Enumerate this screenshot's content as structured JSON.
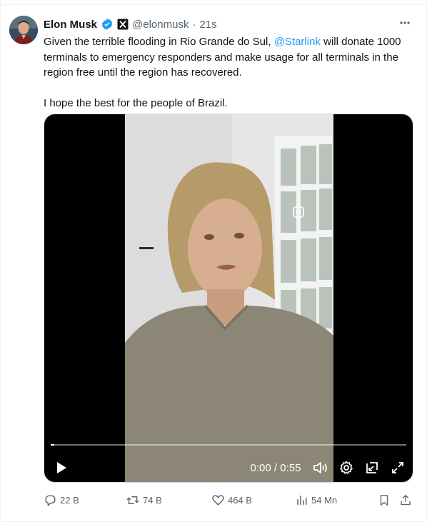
{
  "tweet": {
    "author_name": "Elon Musk",
    "handle": "@elonmusk",
    "separator": "·",
    "time": "21s",
    "text_part1": "Given the terrible flooding in Rio Grande do Sul, ",
    "mention": "@Starlink",
    "text_part2": " will donate 1000 terminals to emergency responders and make usage for all terminals in the region free until the region has recovered.",
    "text_line2": "I hope the best for the people of Brazil."
  },
  "video": {
    "time_readout": "0:00 / 0:55",
    "progress_fraction": 0.01
  },
  "actions": {
    "replies": "22 B",
    "reposts": "74 B",
    "likes": "464 B",
    "views": "54 Mn"
  },
  "colors": {
    "accent": "#1d9bf0",
    "text": "#0f1419",
    "secondary": "#536471",
    "verified": "#1d9bf0"
  }
}
